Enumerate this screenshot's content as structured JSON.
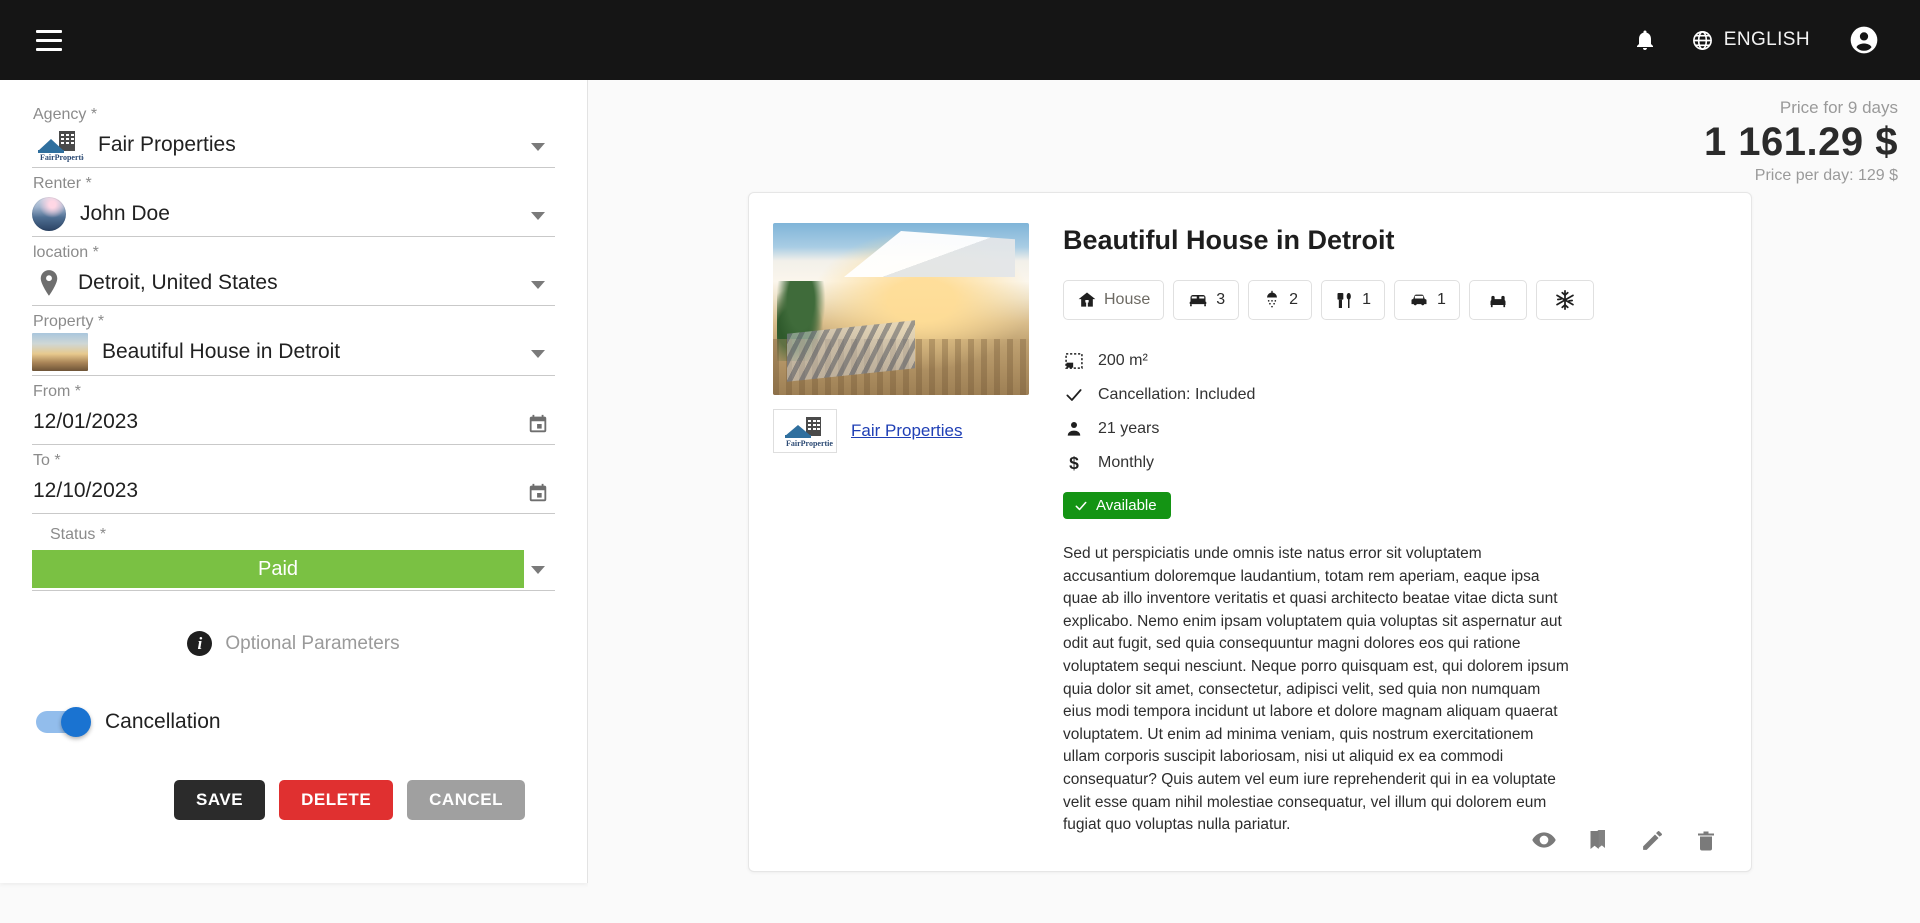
{
  "appbar": {
    "menu_icon": "hamburger-menu-icon",
    "notifications_icon": "bell-icon",
    "language_icon": "globe-icon",
    "language_label": "ENGLISH",
    "account_icon": "account-circle-icon"
  },
  "form": {
    "fields": [
      {
        "label": "Agency",
        "required": "*",
        "value": "Fair Properties",
        "icon": "agency-logo-icon"
      },
      {
        "label": "Renter",
        "required": "*",
        "value": "John Doe",
        "icon": "renter-avatar-icon"
      },
      {
        "label": "location",
        "required": "*",
        "value": "Detroit, United States",
        "icon": "map-pin-icon"
      },
      {
        "label": "Property",
        "required": "*",
        "value": "Beautiful House in Detroit",
        "icon": "property-thumbnail-icon"
      },
      {
        "label": "From",
        "required": "*",
        "value": "12/01/2023",
        "icon": "calendar-icon"
      },
      {
        "label": "To",
        "required": "*",
        "value": "12/10/2023",
        "icon": "calendar-icon"
      }
    ],
    "status": {
      "label": "Status",
      "required": "*",
      "value": "Paid",
      "color": "#7ac143"
    },
    "optional_parameters": {
      "icon": "info-icon",
      "label": "Optional Parameters"
    },
    "cancellation_toggle": {
      "label": "Cancellation",
      "state": "on",
      "track_color": "#92bdec",
      "knob_color": "#1a73d1"
    },
    "buttons": {
      "save": "SAVE",
      "delete": "DELETE",
      "cancel": "CANCEL"
    }
  },
  "price": {
    "period_label": "Price for 9 days",
    "total": "1 161.29 $",
    "per_day_label": "Price per day: 129 $"
  },
  "property_card": {
    "title": "Beautiful House in Detroit",
    "photo_alt": "beautiful-house-photo",
    "agency": {
      "logo": "fair-properties-logo-icon",
      "name": "Fair Properties"
    },
    "chips": [
      {
        "icon": "house-icon",
        "label": "House",
        "value": ""
      },
      {
        "icon": "bed-icon",
        "label": "",
        "value": "3"
      },
      {
        "icon": "shower-icon",
        "label": "",
        "value": "2"
      },
      {
        "icon": "kitchen-icon",
        "label": "",
        "value": "1"
      },
      {
        "icon": "car-icon",
        "label": "",
        "value": "1"
      },
      {
        "icon": "sofa-icon",
        "label": "",
        "value": ""
      },
      {
        "icon": "snowflake-icon",
        "label": "",
        "value": ""
      }
    ],
    "details": [
      {
        "icon": "area-icon",
        "text": "200 m²"
      },
      {
        "icon": "check-icon",
        "text": "Cancellation: Included"
      },
      {
        "icon": "person-icon",
        "text": "21 years"
      },
      {
        "icon": "dollar-icon",
        "text": "Monthly"
      }
    ],
    "availability": {
      "icon": "check-icon",
      "label": "Available",
      "color": "#149414"
    },
    "description": "Sed ut perspiciatis unde omnis iste natus error sit voluptatem accusantium doloremque laudantium, totam rem aperiam, eaque ipsa quae ab illo inventore veritatis et quasi architecto beatae vitae dicta sunt explicabo. Nemo enim ipsam voluptatem quia voluptas sit aspernatur aut odit aut fugit, sed quia consequuntur magni dolores eos qui ratione voluptatem sequi nesciunt. Neque porro quisquam est, qui dolorem ipsum quia dolor sit amet, consectetur, adipisci velit, sed quia non numquam eius modi tempora incidunt ut labore et dolore magnam aliquam quaerat voluptatem. Ut enim ad minima veniam, quis nostrum exercitationem ullam corporis suscipit laboriosam, nisi ut aliquid ex ea commodi consequatur? Quis autem vel eum iure reprehenderit qui in ea voluptate velit esse quam nihil molestiae consequatur, vel illum qui dolorem eum fugiat quo voluptas nulla pariatur.",
    "actions": [
      {
        "icon": "eye-icon"
      },
      {
        "icon": "bookmark-icon"
      },
      {
        "icon": "pencil-icon"
      },
      {
        "icon": "trash-icon"
      }
    ]
  }
}
